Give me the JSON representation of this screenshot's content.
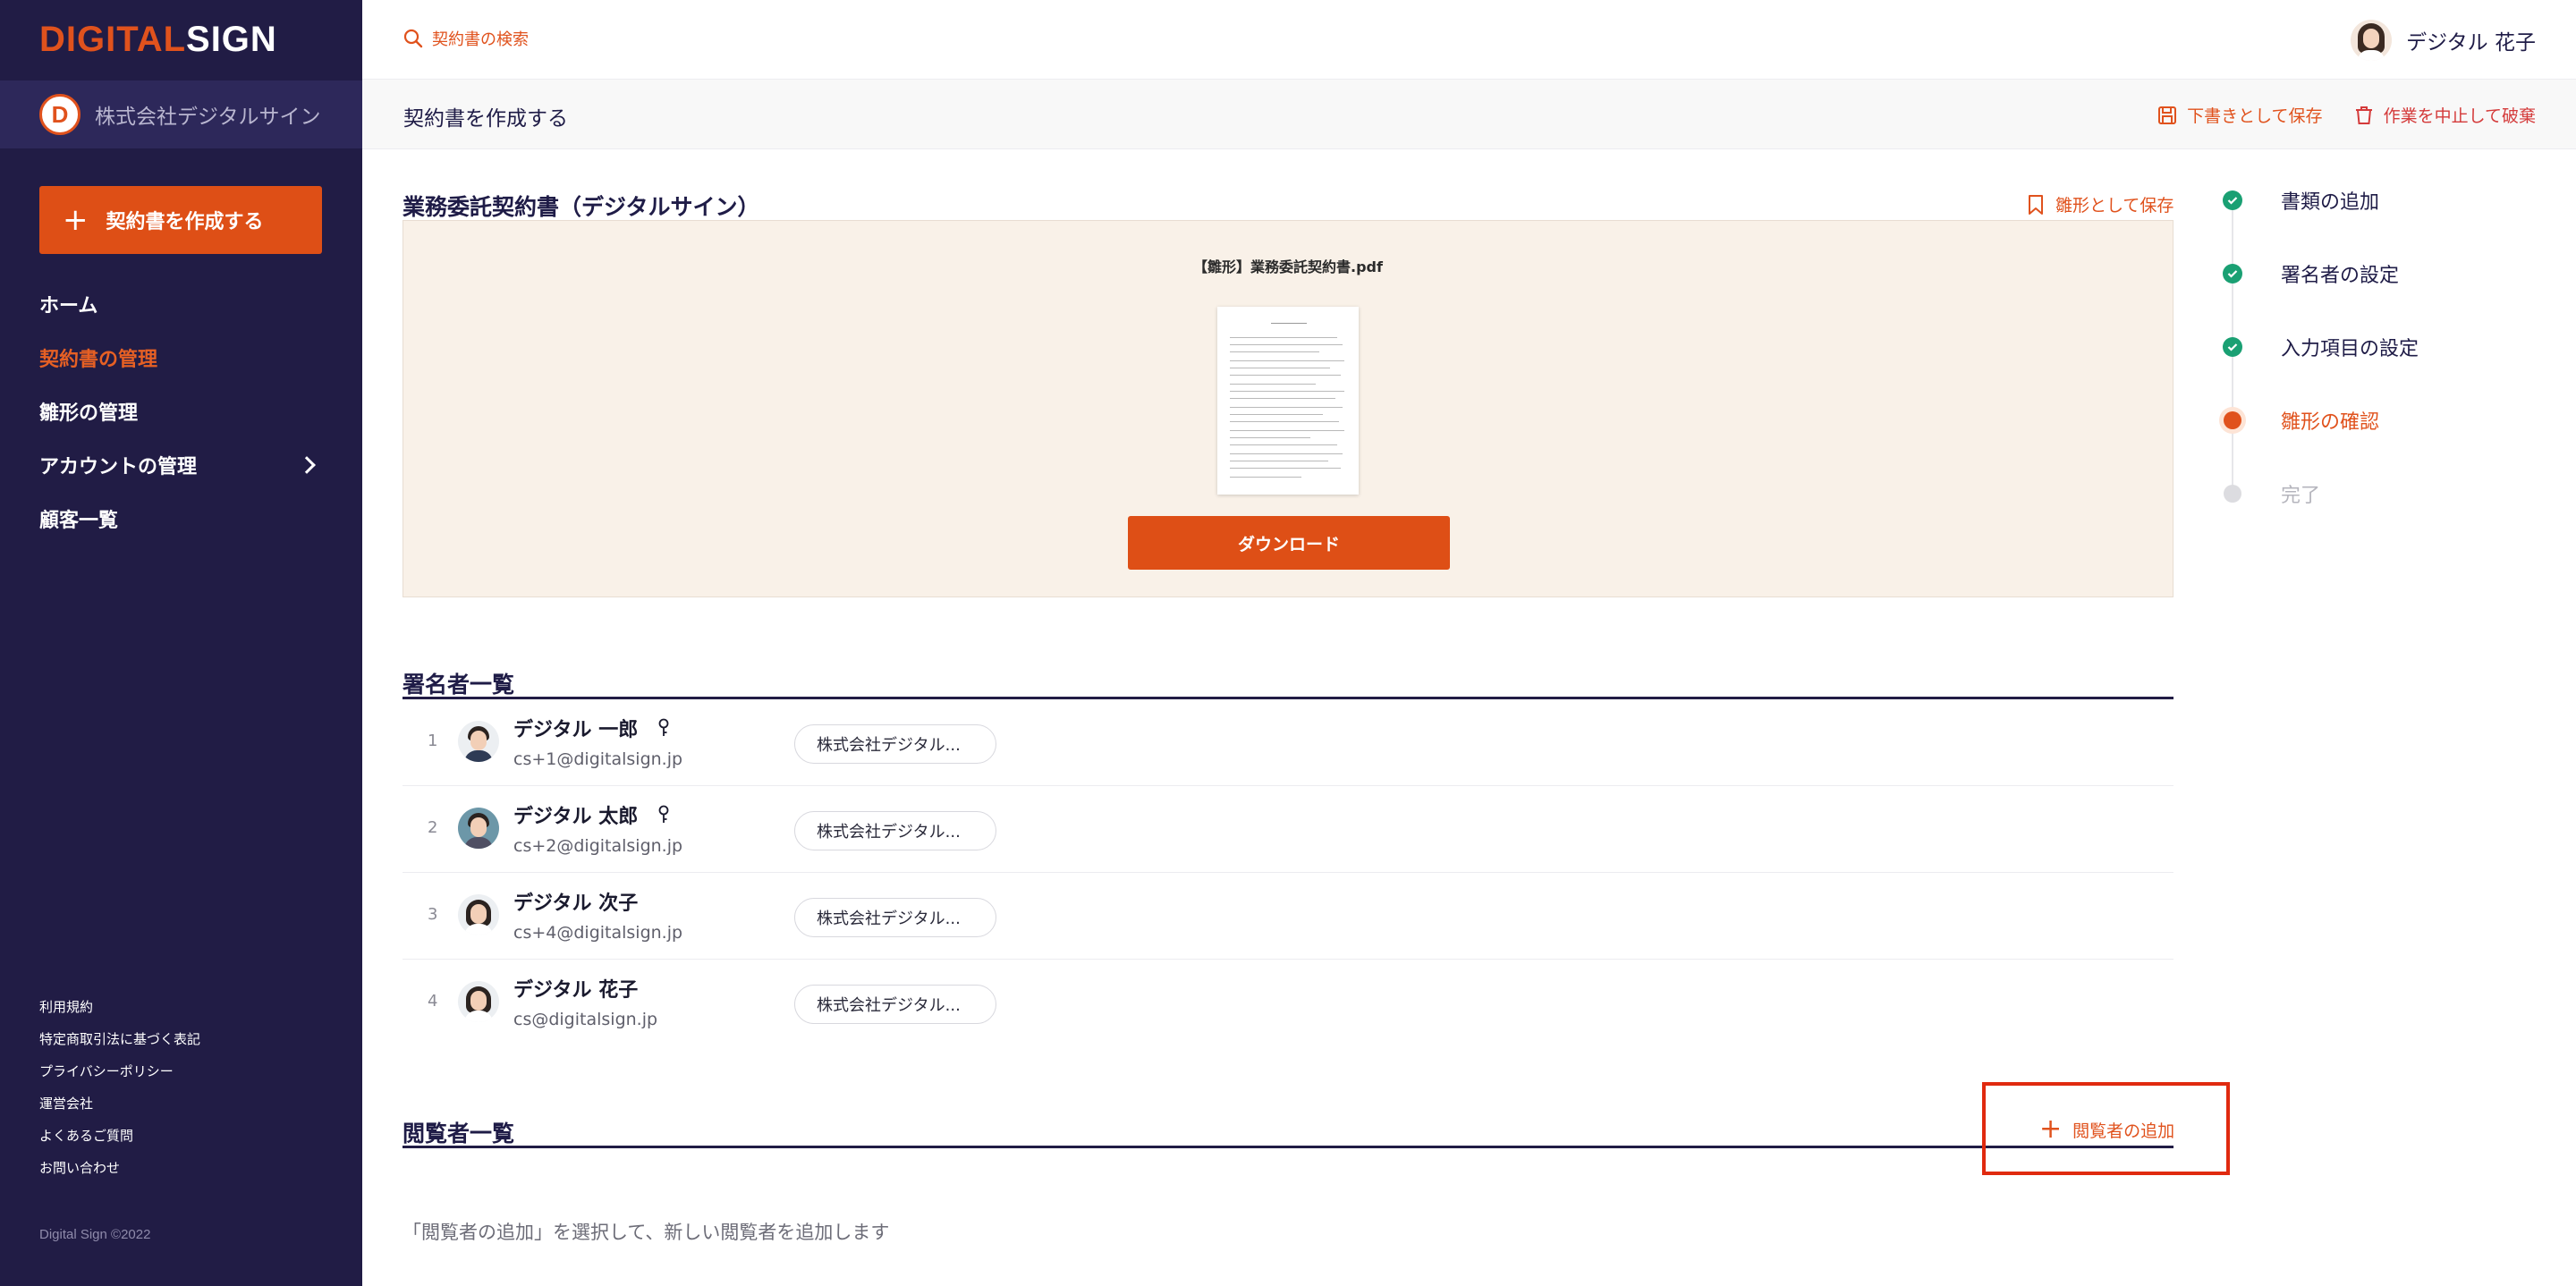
{
  "brand": {
    "part1": "DIGITAL",
    "part2": "SIGN"
  },
  "company": {
    "logo_letter": "D",
    "name": "株式会社デジタルサイン"
  },
  "sidebar": {
    "create_button": "契約書を作成する",
    "items": [
      {
        "label": "ホーム"
      },
      {
        "label": "契約書の管理"
      },
      {
        "label": "雛形の管理"
      },
      {
        "label": "アカウントの管理"
      },
      {
        "label": "顧客一覧"
      }
    ],
    "footer_links": [
      "利用規約",
      "特定商取引法に基づく表記",
      "プライバシーポリシー",
      "運営会社",
      "よくあるご質問",
      "お問い合わせ"
    ],
    "copyright": "Digital Sign ©2022"
  },
  "topbar": {
    "search_placeholder": "契約書の検索",
    "user_name": "デジタル 花子"
  },
  "subheader": {
    "title": "契約書を作成する",
    "save_draft": "下書きとして保存",
    "discard": "作業を中止して破棄"
  },
  "document": {
    "title": "業務委託契約書（デジタルサイン）",
    "save_as_template": "雛形として保存",
    "file_name": "【雛形】業務委託契約書.pdf",
    "download": "ダウンロード"
  },
  "steps": [
    {
      "label": "書類の追加",
      "status": "done"
    },
    {
      "label": "署名者の設定",
      "status": "done"
    },
    {
      "label": "入力項目の設定",
      "status": "done"
    },
    {
      "label": "雛形の確認",
      "status": "current"
    },
    {
      "label": "完了",
      "status": "todo"
    }
  ],
  "signers": {
    "title": "署名者一覧",
    "rows": [
      {
        "num": "1",
        "name": "デジタル 一郎",
        "email": "cs+1@digitalsign.jp",
        "org": "株式会社デジタル..."
      },
      {
        "num": "2",
        "name": "デジタル 太郎",
        "email": "cs+2@digitalsign.jp",
        "org": "株式会社デジタル..."
      },
      {
        "num": "3",
        "name": "デジタル 次子",
        "email": "cs+4@digitalsign.jp",
        "org": "株式会社デジタル..."
      },
      {
        "num": "4",
        "name": "デジタル 花子",
        "email": "cs@digitalsign.jp",
        "org": "株式会社デジタル..."
      }
    ]
  },
  "viewers": {
    "title": "閲覧者一覧",
    "add_label": "閲覧者の追加",
    "empty_text": "「閲覧者の追加」を選択して、新しい閲覧者を追加します"
  },
  "colors": {
    "accent": "#de4f16",
    "sidebar": "#211c45",
    "success": "#1aa073",
    "highlight": "#e02a0f"
  }
}
